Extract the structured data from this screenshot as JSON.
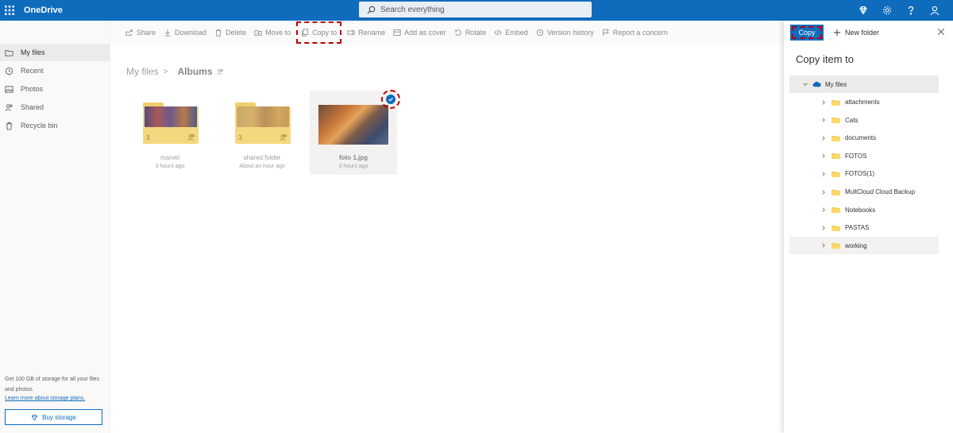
{
  "app": {
    "title": "OneDrive"
  },
  "search": {
    "placeholder": "Search everything"
  },
  "top_icons": [
    "diamond-icon",
    "gear-icon",
    "help-icon",
    "account-icon"
  ],
  "nav": {
    "items": [
      {
        "label": "My files",
        "icon": "folder-icon",
        "active": true
      },
      {
        "label": "Recent",
        "icon": "clock-icon"
      },
      {
        "label": "Photos",
        "icon": "image-icon"
      },
      {
        "label": "Shared",
        "icon": "people-icon"
      },
      {
        "label": "Recycle bin",
        "icon": "trash-icon"
      }
    ],
    "storage_text": "Get 100 GB of storage for all your files and photos.",
    "storage_link": "Learn more about storage plans.",
    "buy_label": "Buy storage"
  },
  "commands": [
    {
      "label": "Share",
      "icon": "share-icon"
    },
    {
      "label": "Download",
      "icon": "download-icon"
    },
    {
      "label": "Delete",
      "icon": "trash-icon"
    },
    {
      "label": "Move to",
      "icon": "move-icon"
    },
    {
      "label": "Copy to",
      "icon": "copy-icon"
    },
    {
      "label": "Rename",
      "icon": "rename-icon"
    },
    {
      "label": "Add as cover",
      "icon": "cover-icon"
    },
    {
      "label": "Rotate",
      "icon": "rotate-icon"
    },
    {
      "label": "Embed",
      "icon": "embed-icon"
    },
    {
      "label": "Version history",
      "icon": "history-icon"
    },
    {
      "label": "Report a concern",
      "icon": "report-icon"
    }
  ],
  "breadcrumb": {
    "parent": "My files",
    "separator": ">",
    "current": "Albums"
  },
  "tiles": [
    {
      "name": "marvel",
      "time": "3 hours ago",
      "count": "3",
      "type": "folder"
    },
    {
      "name": "shared folder",
      "time": "About an hour ago",
      "count": "3",
      "type": "folder"
    },
    {
      "name": "foto 1.jpg",
      "time": "3 hours ago",
      "type": "photo",
      "selected": true
    }
  ],
  "panel": {
    "copy_label": "Copy",
    "new_folder_label": "New folder",
    "title": "Copy item to",
    "root": "My files",
    "folders": [
      "attachments",
      "Cats",
      "documents",
      "FOTOS",
      "FOTOS(1)",
      "MultCloud Cloud Backup",
      "Notebooks",
      "PASTAS",
      "working"
    ]
  },
  "colors": {
    "brand": "#0f6cbd",
    "folder": "#f4d77f",
    "highlight": "#c00000"
  }
}
